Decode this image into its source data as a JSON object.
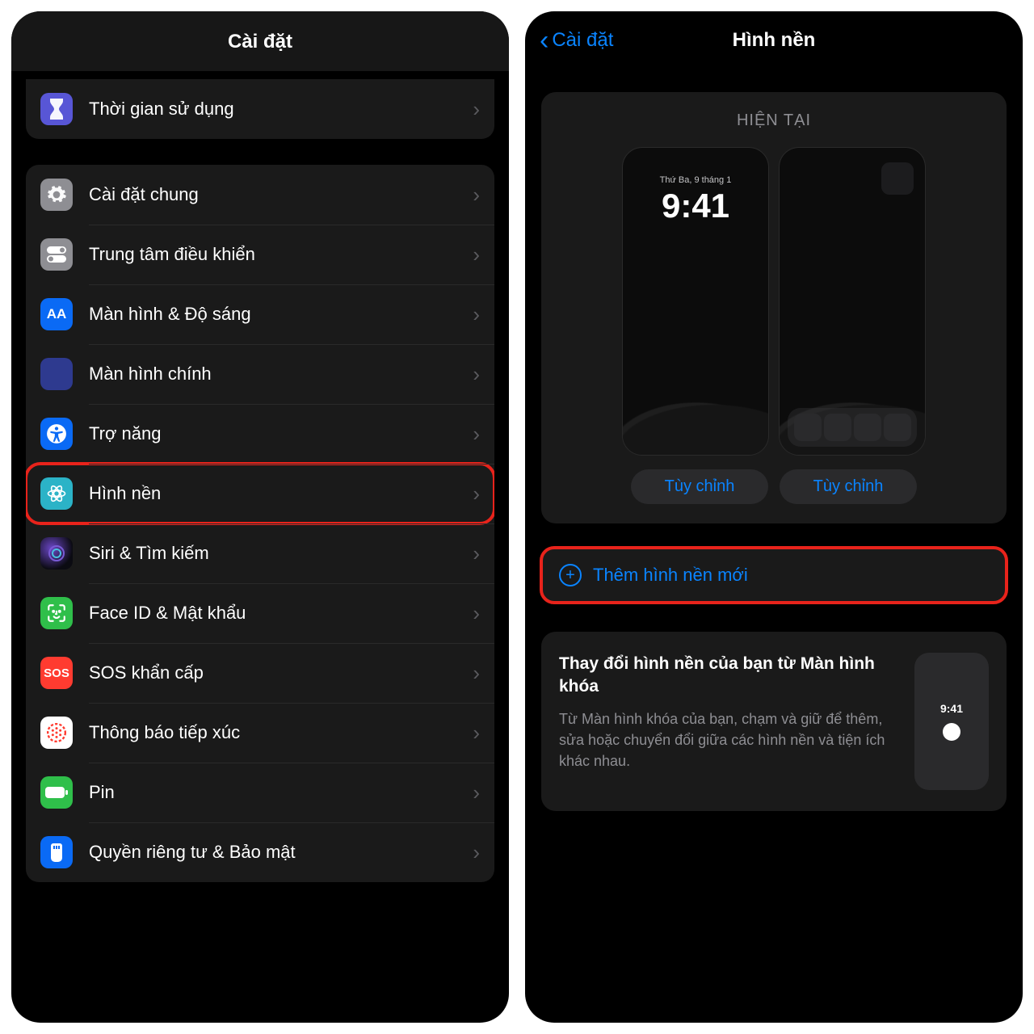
{
  "left": {
    "title": "Cài đặt",
    "group_top": [
      {
        "label": "Thời gian sử dụng",
        "icon": "hourglass",
        "icon_class": "ic-hourglass"
      }
    ],
    "group_main": [
      {
        "label": "Cài đặt chung",
        "icon": "gear",
        "icon_class": "ic-gear"
      },
      {
        "label": "Trung tâm điều khiển",
        "icon": "toggles",
        "icon_class": "ic-toggles"
      },
      {
        "label": "Màn hình & Độ sáng",
        "icon": "text-size",
        "icon_class": "ic-display",
        "glyph": "AA"
      },
      {
        "label": "Màn hình chính",
        "icon": "apps-grid",
        "icon_class": "ic-apps"
      },
      {
        "label": "Trợ năng",
        "icon": "accessibility",
        "icon_class": "ic-access"
      },
      {
        "label": "Hình nền",
        "icon": "wallpaper-flower",
        "icon_class": "ic-wallpaper",
        "highlighted": true
      },
      {
        "label": "Siri & Tìm kiếm",
        "icon": "siri",
        "icon_class": "ic-siri"
      },
      {
        "label": "Face ID & Mật khẩu",
        "icon": "faceid",
        "icon_class": "ic-faceid"
      },
      {
        "label": "SOS khẩn cấp",
        "icon": "sos",
        "icon_class": "ic-sos",
        "glyph": "SOS"
      },
      {
        "label": "Thông báo tiếp xúc",
        "icon": "exposure",
        "icon_class": "ic-exposure"
      },
      {
        "label": "Pin",
        "icon": "battery",
        "icon_class": "ic-battery"
      },
      {
        "label": "Quyền riêng tư & Bảo mật",
        "icon": "hand-privacy",
        "icon_class": "ic-privacy"
      }
    ]
  },
  "right": {
    "back_label": "Cài đặt",
    "title": "Hình nền",
    "current_label": "HIỆN TẠI",
    "lock_date": "Thứ Ba, 9 tháng 1",
    "lock_time": "9:41",
    "customize_label": "Tùy chỉnh",
    "add_label": "Thêm hình nền mới",
    "tip_title": "Thay đổi hình nền của bạn từ Màn hình khóa",
    "tip_body": "Từ Màn hình khóa của bạn, chạm và giữ để thêm, sửa hoặc chuyển đổi giữa các hình nền và tiện ích khác nhau.",
    "tip_time": "9:41"
  }
}
